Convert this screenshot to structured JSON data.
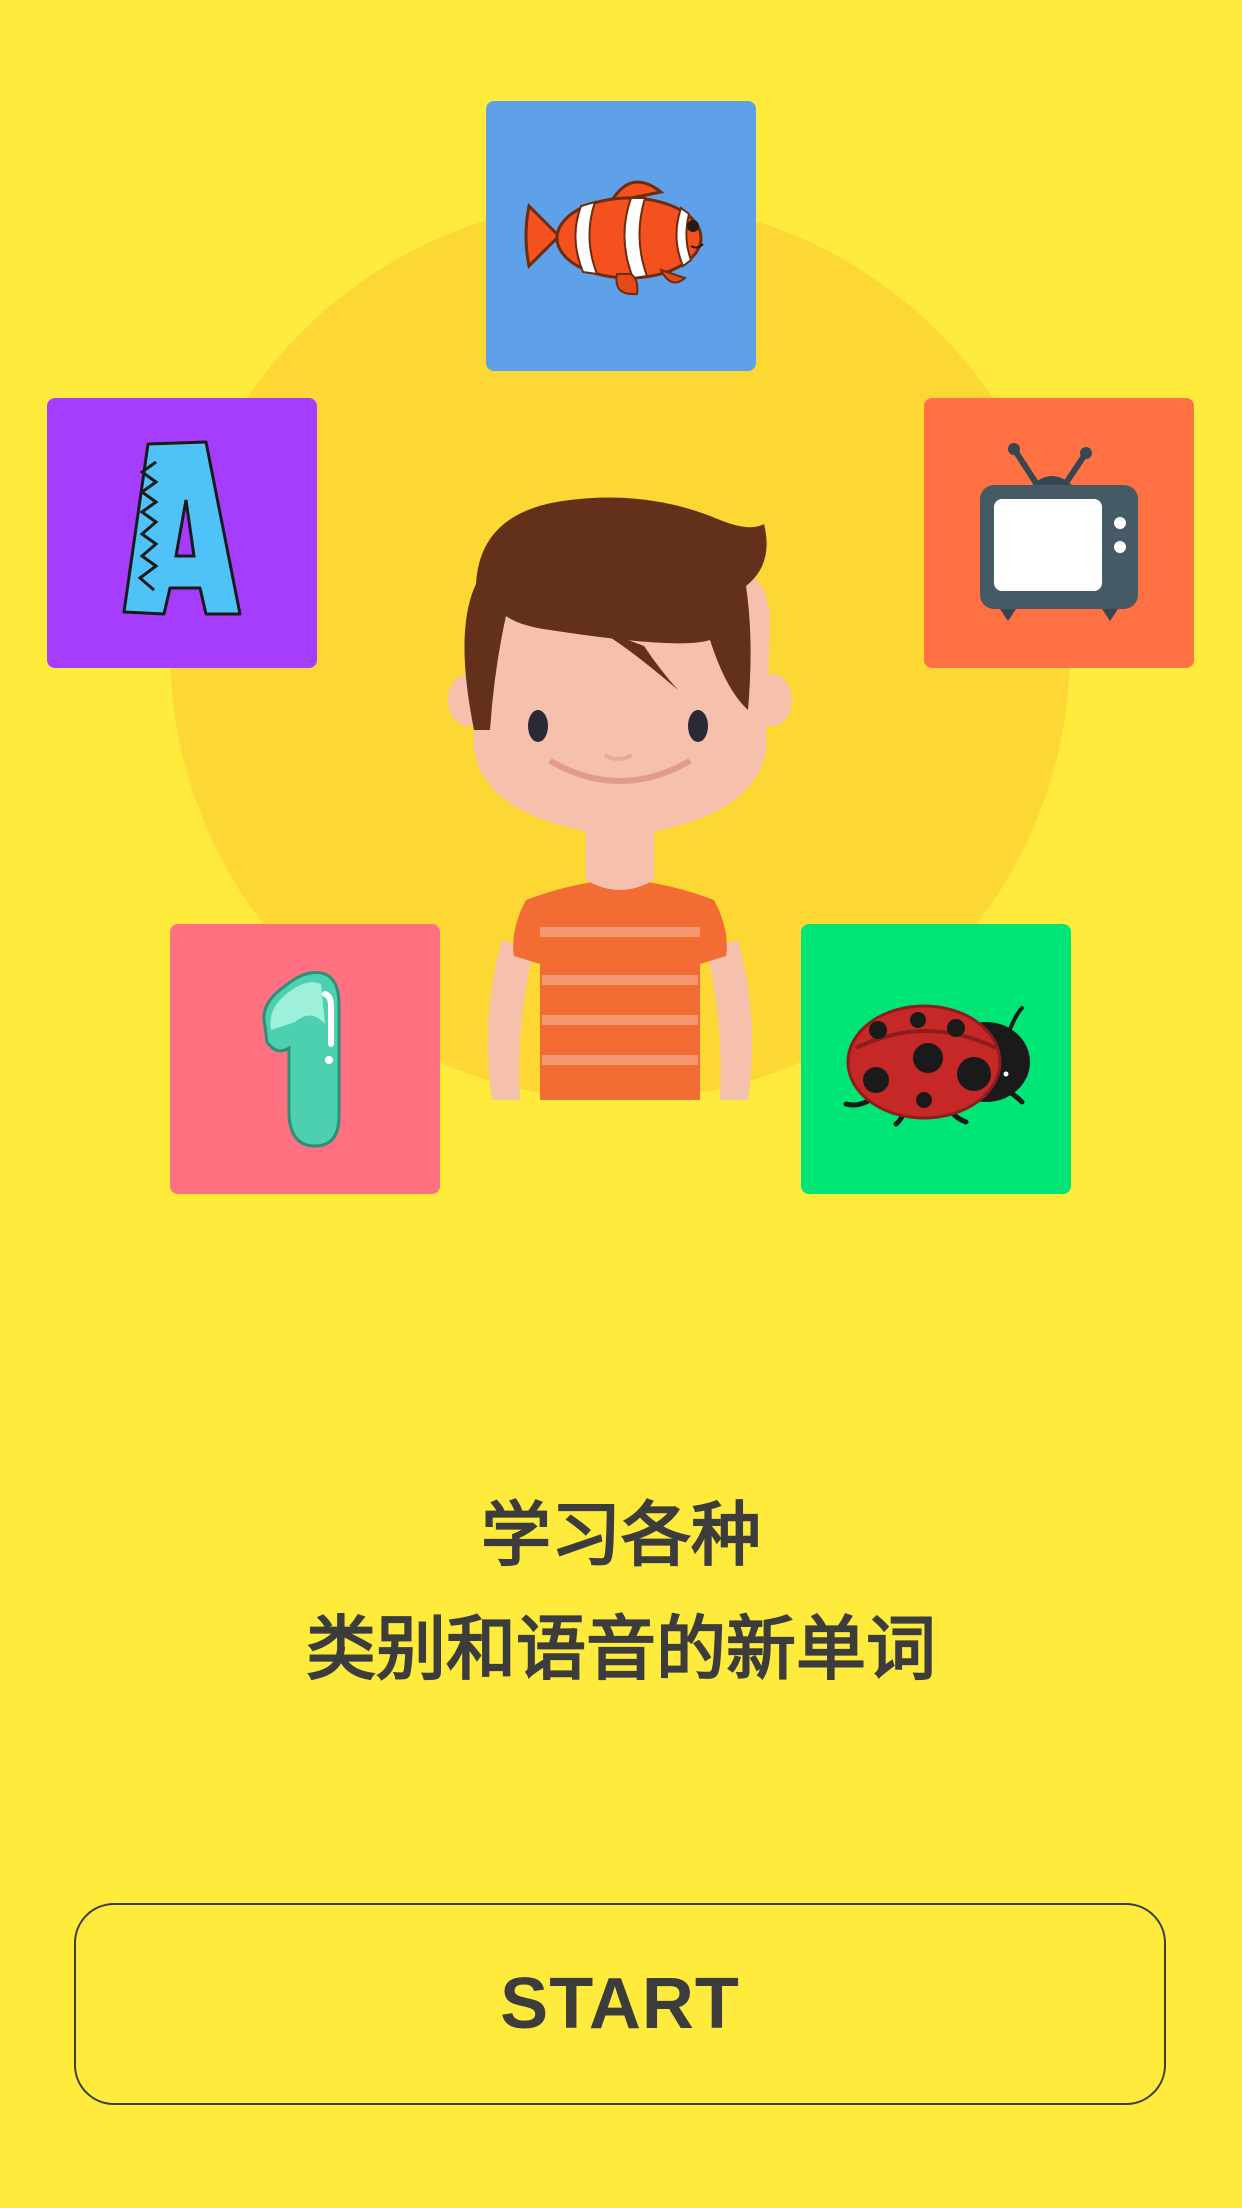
{
  "colors": {
    "background": "#FFEB3B",
    "halo": "#FDD835",
    "text": "#3C3C3C"
  },
  "cards": [
    {
      "name": "fish",
      "icon": "clownfish-icon",
      "color": "#5EA1E8"
    },
    {
      "name": "letter",
      "icon": "letter-a-icon",
      "color": "#A53DFF"
    },
    {
      "name": "tv",
      "icon": "television-icon",
      "color": "#FF7043"
    },
    {
      "name": "number",
      "icon": "number-one-icon",
      "color": "#FF7080"
    },
    {
      "name": "bug",
      "icon": "ladybug-icon",
      "color": "#00E676"
    }
  ],
  "headline": {
    "line1": "学习各种",
    "line2": "类别和语音的新单词"
  },
  "start_button": {
    "label": "START"
  }
}
